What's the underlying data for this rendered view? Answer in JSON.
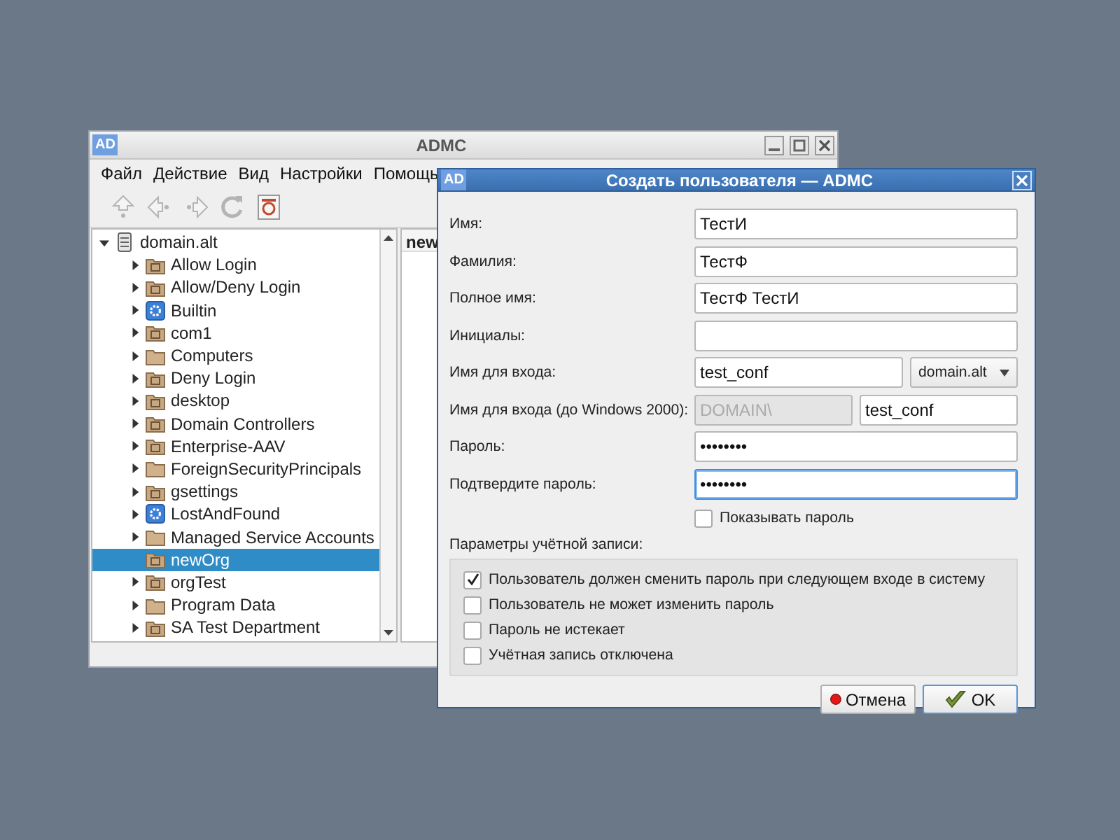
{
  "main_window": {
    "logo": "AD",
    "title": "ADMC",
    "menu": [
      "Файл",
      "Действие",
      "Вид",
      "Настройки",
      "Помощь"
    ],
    "toolbar": [
      {
        "kind": "up",
        "disabled": true
      },
      {
        "kind": "back",
        "disabled": true
      },
      {
        "kind": "forward",
        "disabled": true
      },
      {
        "kind": "refresh",
        "disabled": true
      },
      {
        "kind": "filter",
        "disabled": false
      }
    ],
    "tree": {
      "label": "domain.alt",
      "expanded": true,
      "children": [
        {
          "label": "Allow Login",
          "kind": "ou",
          "expandable": true,
          "selected": false
        },
        {
          "label": "Allow/Deny Login",
          "kind": "ou",
          "expandable": true,
          "selected": false
        },
        {
          "label": "Builtin",
          "kind": "container",
          "expandable": true,
          "selected": false
        },
        {
          "label": "com1",
          "kind": "ou",
          "expandable": true,
          "selected": false
        },
        {
          "label": "Computers",
          "kind": "folder",
          "expandable": true,
          "selected": false
        },
        {
          "label": "Deny Login",
          "kind": "ou",
          "expandable": true,
          "selected": false
        },
        {
          "label": "desktop",
          "kind": "ou",
          "expandable": true,
          "selected": false
        },
        {
          "label": "Domain Controllers",
          "kind": "ou",
          "expandable": true,
          "selected": false
        },
        {
          "label": "Enterprise-AAV",
          "kind": "ou",
          "expandable": true,
          "selected": false
        },
        {
          "label": "ForeignSecurityPrincipals",
          "kind": "folder",
          "expandable": true,
          "selected": false
        },
        {
          "label": "gsettings",
          "kind": "ou",
          "expandable": true,
          "selected": false
        },
        {
          "label": "LostAndFound",
          "kind": "container",
          "expandable": true,
          "selected": false
        },
        {
          "label": "Managed Service Accounts",
          "kind": "folder",
          "expandable": true,
          "selected": false
        },
        {
          "label": "newOrg",
          "kind": "ou",
          "expandable": false,
          "selected": true
        },
        {
          "label": "orgTest",
          "kind": "ou",
          "expandable": true,
          "selected": false
        },
        {
          "label": "Program Data",
          "kind": "folder",
          "expandable": true,
          "selected": false
        },
        {
          "label": "SA Test Department",
          "kind": "ou",
          "expandable": true,
          "selected": false
        }
      ]
    },
    "content_header": "new"
  },
  "dialog": {
    "logo": "AD",
    "title": "Создать пользователя — ADMC",
    "fields": [
      {
        "label": "Имя:",
        "kind": "text",
        "value": "ТестИ",
        "focused": false
      },
      {
        "label": "Фамилия:",
        "kind": "text",
        "value": "ТестФ",
        "focused": false
      },
      {
        "label": "Полное имя:",
        "kind": "text",
        "value": "ТестФ ТестИ",
        "focused": false
      },
      {
        "label": "Инициалы:",
        "kind": "text",
        "focused": false
      },
      {
        "label": "Имя для входа:",
        "kind": "text_select",
        "value": "test_conf",
        "select": "domain.alt",
        "focused": false
      },
      {
        "label": "Имя для входа (до Windows 2000):",
        "kind": "prefixed",
        "prefix": "DOMAIN\\",
        "value": "test_conf",
        "focused": false
      },
      {
        "label": "Пароль:",
        "kind": "text",
        "value": "••••••••",
        "focused": false
      },
      {
        "label": "Подтвердите пароль:",
        "kind": "text",
        "value": "••••••••",
        "focused": true
      }
    ],
    "show_password": {
      "label": "Показывать пароль",
      "checked": false
    },
    "options_label": "Параметры учётной записи:",
    "options": [
      {
        "label": "Пользователь должен сменить пароль при следующем входе в систему",
        "checked": true
      },
      {
        "label": "Пользователь не может изменить пароль",
        "checked": false
      },
      {
        "label": "Пароль не истекает",
        "checked": false
      },
      {
        "label": "Учётная запись отключена",
        "checked": false
      }
    ],
    "buttons": [
      {
        "label": "Отмена",
        "kind": "cancel",
        "default": false
      },
      {
        "label": "OK",
        "kind": "ok",
        "default": true
      }
    ]
  }
}
